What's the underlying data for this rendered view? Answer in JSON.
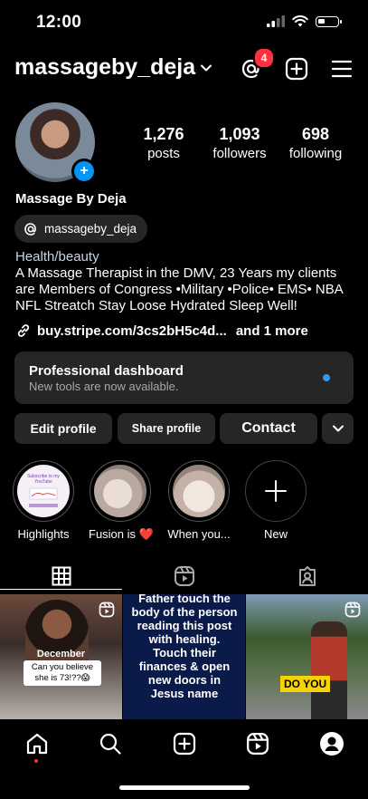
{
  "status_bar": {
    "time": "12:00"
  },
  "header": {
    "username": "massageby_deja",
    "threads_badge_count": "4"
  },
  "profile": {
    "display_name": "Massage By Deja",
    "threads_handle": "massageby_deja",
    "category": "Health/beauty",
    "bio": "A Massage Therapist in the DMV, 23 Years my clients are Members of Congress •Military •Police• EMS• NBA NFL Streatch Stay Loose Hydrated Sleep Well!",
    "link": "buy.stripe.com/3cs2bH5c4d...",
    "link_more": "and 1 more",
    "stats": [
      {
        "value": "1,276",
        "label": "posts"
      },
      {
        "value": "1,093",
        "label": "followers"
      },
      {
        "value": "698",
        "label": "following"
      }
    ]
  },
  "dashboard": {
    "title": "Professional dashboard",
    "subtitle": "New tools are now available."
  },
  "actions": {
    "edit_profile": "Edit profile",
    "share_profile": "Share profile",
    "contact": "Contact"
  },
  "highlights": [
    {
      "label": "Highlights",
      "cover_text": "Subscribe to my YouTube"
    },
    {
      "label": "Fusion is ❤️"
    },
    {
      "label": "When you..."
    },
    {
      "label": "New"
    }
  ],
  "tabs": [
    "grid-icon",
    "reels-icon",
    "tagged-icon"
  ],
  "posts": [
    {
      "overlay_title": "December",
      "caption": "Can you believe she is 73!??😱"
    },
    {
      "text": "Father touch the body of the person reading this post with healing. Touch their finances & open new doors in Jesus name"
    },
    {
      "caption": "DO YOU"
    }
  ],
  "bottom_nav": [
    "home-icon",
    "search-icon",
    "create-icon",
    "reels-icon",
    "profile-icon"
  ],
  "colors": {
    "accent": "#0095f6",
    "badge": "#ff3040",
    "surface": "#262626"
  }
}
